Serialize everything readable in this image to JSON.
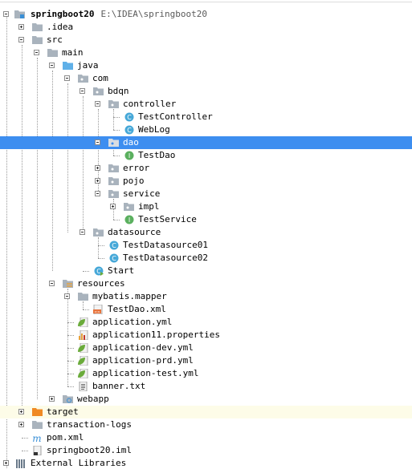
{
  "tree": {
    "project": {
      "name": "springboot20",
      "path": "E:\\IDEA\\springboot20"
    },
    "items": {
      "idea": ".idea",
      "src": "src",
      "main": "main",
      "java": "java",
      "com": "com",
      "bdqn": "bdqn",
      "controller": "controller",
      "test_controller": "TestController",
      "weblog": "WebLog",
      "dao": "dao",
      "test_dao": "TestDao",
      "error": "error",
      "pojo": "pojo",
      "service": "service",
      "impl": "impl",
      "test_service": "TestService",
      "datasource": "datasource",
      "test_datasource01": "TestDatasource01",
      "test_datasource02": "TestDatasource02",
      "start": "Start",
      "resources": "resources",
      "mybatis_mapper": "mybatis.mapper",
      "test_dao_xml": "TestDao.xml",
      "application_yml": "application.yml",
      "application11_properties": "application11.properties",
      "application_dev_yml": "application-dev.yml",
      "application_prd_yml": "application-prd.yml",
      "application_test_yml": "application-test.yml",
      "banner_txt": "banner.txt",
      "webapp": "webapp",
      "target": "target",
      "transaction_logs": "transaction-logs",
      "pom_xml": "pom.xml",
      "springboot20_iml": "springboot20.iml",
      "external_libraries": "External Libraries"
    }
  },
  "colors": {
    "selection": "#3d8ef0",
    "excluded_row": "#fdfce8",
    "folder": "#a9b3bd",
    "source_folder": "#5fb0e8",
    "excluded_folder": "#f08a24",
    "class_icon": "#46a8d8",
    "interface_icon": "#5bb05f",
    "spring_green": "#6aab3a"
  }
}
